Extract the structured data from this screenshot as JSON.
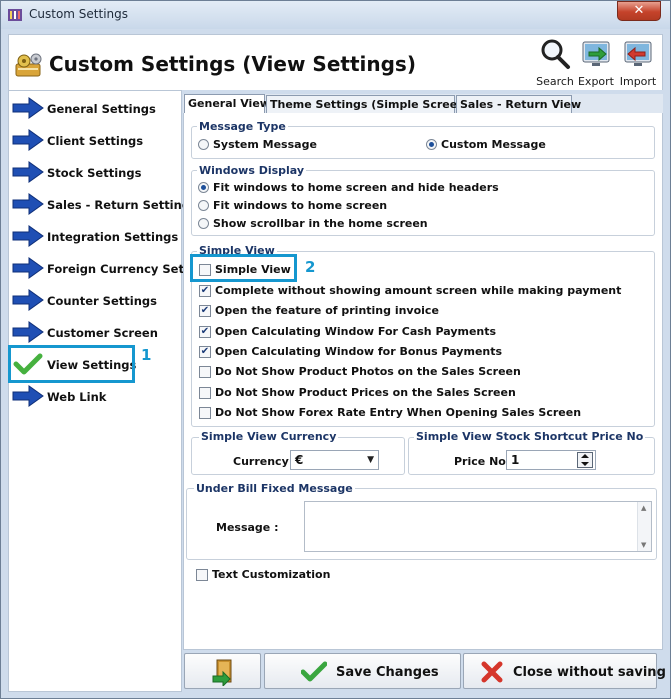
{
  "window": {
    "title": "Custom Settings",
    "close_glyph": "✕"
  },
  "header": {
    "title": "Custom Settings (View Settings)",
    "tools": [
      {
        "label": "Search",
        "icon": "search-icon"
      },
      {
        "label": "Export",
        "icon": "export-icon"
      },
      {
        "label": "Import",
        "icon": "import-icon"
      }
    ]
  },
  "sidebar": {
    "items": [
      {
        "label": "General Settings",
        "icon": "arrow-right-icon"
      },
      {
        "label": "Client Settings",
        "icon": "arrow-right-icon"
      },
      {
        "label": "Stock Settings",
        "icon": "arrow-right-icon"
      },
      {
        "label": "Sales - Return Settings",
        "icon": "arrow-right-icon"
      },
      {
        "label": "Integration Settings",
        "icon": "arrow-right-icon"
      },
      {
        "label": "Foreign Currency Settin",
        "icon": "arrow-right-icon"
      },
      {
        "label": "Counter Settings",
        "icon": "arrow-right-icon"
      },
      {
        "label": "Customer Screen",
        "icon": "arrow-right-icon"
      },
      {
        "label": "View Settings",
        "icon": "checkmark-icon"
      },
      {
        "label": "Web Link",
        "icon": "arrow-right-icon"
      }
    ]
  },
  "tabs": [
    {
      "label": "General View",
      "active": true
    },
    {
      "label": "Theme Settings (Simple Screen)",
      "active": false
    },
    {
      "label": "Sales - Return View",
      "active": false
    }
  ],
  "message_type": {
    "title": "Message Type",
    "options": [
      {
        "label": "System Message",
        "selected": false
      },
      {
        "label": "Custom Message",
        "selected": true
      }
    ]
  },
  "windows_display": {
    "title": "Windows Display",
    "options": [
      {
        "label": "Fit windows to home screen and hide headers",
        "selected": true
      },
      {
        "label": "Fit windows to home screen",
        "selected": false
      },
      {
        "label": "Show scrollbar in the home screen",
        "selected": false
      }
    ]
  },
  "simple_view": {
    "title": "Simple View",
    "options": [
      {
        "label": "Simple View",
        "checked": false
      },
      {
        "label": "Complete without showing amount screen while making payment",
        "checked": true
      },
      {
        "label": "Open the feature of printing invoice",
        "checked": true
      },
      {
        "label": "Open Calculating Window For Cash Payments",
        "checked": true
      },
      {
        "label": "Open Calculating Window for Bonus Payments",
        "checked": true
      },
      {
        "label": "Do Not Show Product Photos on the Sales Screen",
        "checked": false
      },
      {
        "label": "Do Not Show Product Prices on the Sales Screen",
        "checked": false
      },
      {
        "label": "Do Not Show Forex Rate Entry When Opening Sales Screen",
        "checked": false
      }
    ]
  },
  "currency": {
    "title": "Simple View Currency",
    "label": "Currency",
    "value": "€"
  },
  "shortcut": {
    "title": "Simple View Stock Shortcut Price No",
    "label": "Price No",
    "value": "1"
  },
  "bill_message": {
    "title": "Under Bill Fixed Message",
    "label": "Message :",
    "value": ""
  },
  "text_customization": {
    "label": "Text Customization",
    "checked": false
  },
  "buttons": {
    "save": "Save Changes",
    "close": "Close without saving"
  },
  "annotations": {
    "first": "1",
    "second": "2"
  },
  "check_glyph": "✔",
  "colors": {
    "highlight": "#1597cf",
    "group_title": "#1c3566",
    "arrow_blue": "#1f4fb4"
  }
}
